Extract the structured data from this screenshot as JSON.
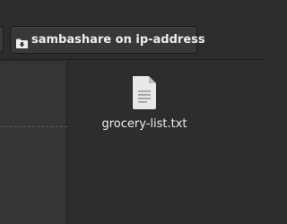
{
  "header": {
    "path_button": {
      "icon": "network-folder-icon",
      "label": "sambashare on ip-address"
    }
  },
  "content": {
    "files": [
      {
        "name": "grocery-list.txt",
        "icon": "text-file-icon"
      }
    ]
  }
}
